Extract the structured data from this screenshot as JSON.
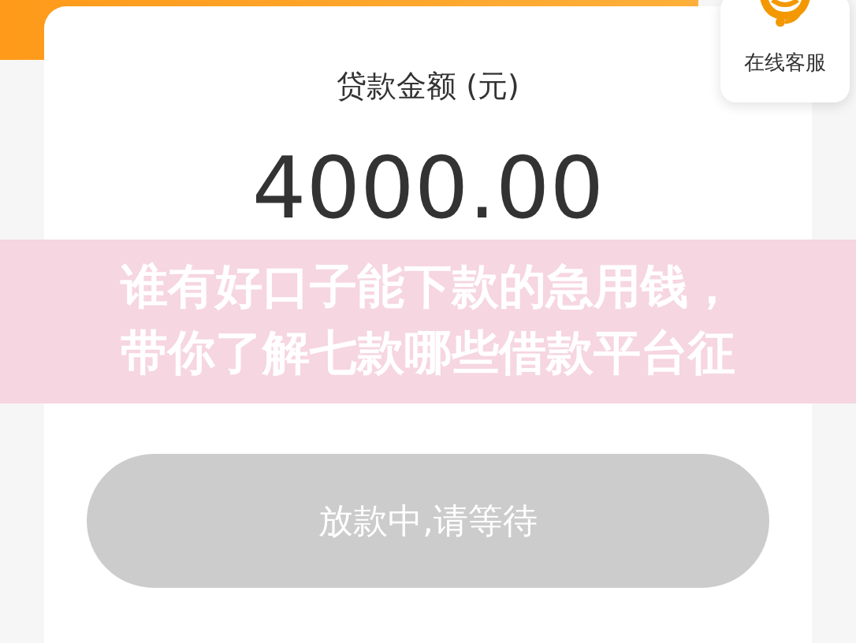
{
  "customer_service": {
    "label": "在线客服"
  },
  "loan": {
    "label": "贷款金额 (元)",
    "amount": "4000.00"
  },
  "status_button": {
    "label": "放款中,请等待",
    "disabled": true
  },
  "caption": {
    "lines": [
      "谁有好口子能下款的急用钱，",
      "带你了解七款哪些借款平台征"
    ]
  }
}
